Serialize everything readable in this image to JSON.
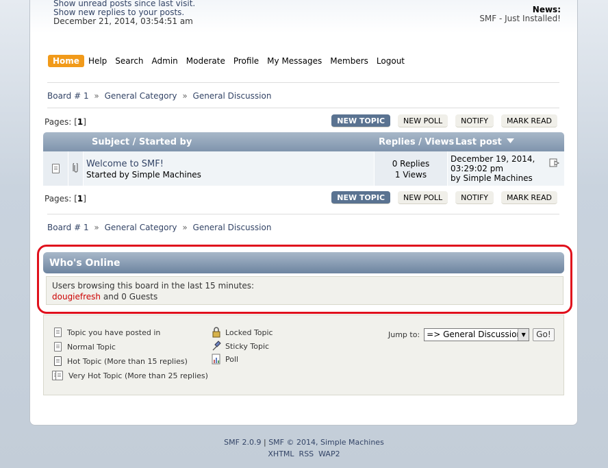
{
  "header": {
    "unread_posts_link": "Show unread posts since last visit.",
    "new_replies_link": "Show new replies to your posts.",
    "date": "December 21, 2014, 03:54:51 am",
    "news_label": "News:",
    "news_text": "SMF - Just Installed!"
  },
  "menu": [
    {
      "label": "Home",
      "active": true
    },
    {
      "label": "Help"
    },
    {
      "label": "Search"
    },
    {
      "label": "Admin"
    },
    {
      "label": "Moderate"
    },
    {
      "label": "Profile"
    },
    {
      "label": "My Messages"
    },
    {
      "label": "Members"
    },
    {
      "label": "Logout"
    }
  ],
  "linktree": {
    "board": "Board # 1",
    "sep": "»",
    "category": "General Category",
    "discussion": "General Discussion"
  },
  "pagination": {
    "label": "Pages:",
    "open": "[",
    "current": "1",
    "close": "]"
  },
  "buttons": {
    "new_topic": "NEW TOPIC",
    "new_poll": "NEW POLL",
    "notify": "NOTIFY",
    "mark_read": "MARK READ"
  },
  "table": {
    "col_subject": "Subject / Started by",
    "col_replies": "Replies / Views",
    "col_lastpost": "Last post",
    "sort_icon": "triangle-down-icon",
    "rows": [
      {
        "title": "Welcome to SMF!",
        "starter": "Started by Simple Machines",
        "replies": "0 Replies",
        "views": "1 Views",
        "last_date": "December 19, 2014,",
        "last_time": "03:29:02 pm",
        "last_by": "by Simple Machines"
      }
    ]
  },
  "whos_online": {
    "title": "Who's Online",
    "line1": "Users browsing this board in the last 15 minutes:",
    "user": "dougiefresh",
    "guests": "and 0 Guests"
  },
  "legend": {
    "items": [
      "Topic you have posted in",
      "Normal Topic",
      "Hot Topic (More than 15 replies)",
      "Very Hot Topic (More than 25 replies)",
      "Locked Topic",
      "Sticky Topic",
      "Poll"
    ],
    "jump_label": "Jump to:",
    "jump_value": "=> General Discussion",
    "go_label": "Go!"
  },
  "footer": {
    "smf_version": "SMF 2.0.9",
    "sep": "|",
    "copyright": "SMF © 2014, Simple Machines",
    "xhtml": "XHTML",
    "rss": "RSS",
    "wap2": "WAP2"
  },
  "colors": {
    "accent": "#f19a1a",
    "header_bar": "#7f94ad",
    "highlight_ring": "#e0101c",
    "username": "#cc0000"
  }
}
